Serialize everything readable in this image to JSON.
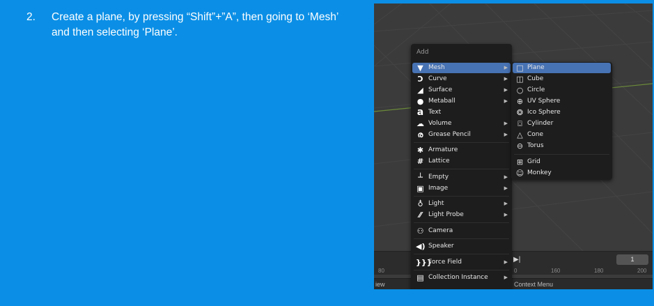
{
  "instruction": {
    "number": "2.",
    "text": "Create a plane, by pressing “Shift”+”A”, then going to ‘Mesh’ and then selecting ‘Plane’."
  },
  "add_menu": {
    "title": "Add",
    "items": [
      {
        "label": "Mesh",
        "icon": "mesh-icon",
        "submenu": true,
        "active": true
      },
      {
        "label": "Curve",
        "icon": "curve-icon",
        "submenu": true
      },
      {
        "label": "Surface",
        "icon": "surface-icon",
        "submenu": true
      },
      {
        "label": "Metaball",
        "icon": "metaball-icon",
        "submenu": true
      },
      {
        "label": "Text",
        "icon": "text-icon",
        "submenu": false
      },
      {
        "label": "Volume",
        "icon": "volume-icon",
        "submenu": true
      },
      {
        "label": "Grease Pencil",
        "icon": "grease-pencil-icon",
        "submenu": true
      },
      {
        "label": "Armature",
        "icon": "armature-icon",
        "submenu": false
      },
      {
        "label": "Lattice",
        "icon": "lattice-icon",
        "submenu": false
      },
      {
        "label": "Empty",
        "icon": "empty-icon",
        "submenu": true
      },
      {
        "label": "Image",
        "icon": "image-icon",
        "submenu": true
      },
      {
        "label": "Light",
        "icon": "light-icon",
        "submenu": true
      },
      {
        "label": "Light Probe",
        "icon": "light-probe-icon",
        "submenu": true
      },
      {
        "label": "Camera",
        "icon": "camera-icon",
        "submenu": false
      },
      {
        "label": "Speaker",
        "icon": "speaker-icon",
        "submenu": false
      },
      {
        "label": "Force Field",
        "icon": "force-field-icon",
        "submenu": true
      },
      {
        "label": "Collection Instance",
        "icon": "collection-icon",
        "submenu": true
      }
    ]
  },
  "mesh_submenu": {
    "items": [
      {
        "label": "Plane",
        "icon": "plane-icon",
        "active": true
      },
      {
        "label": "Cube",
        "icon": "cube-icon"
      },
      {
        "label": "Circle",
        "icon": "circle-icon"
      },
      {
        "label": "UV Sphere",
        "icon": "uv-sphere-icon"
      },
      {
        "label": "Ico Sphere",
        "icon": "ico-sphere-icon"
      },
      {
        "label": "Cylinder",
        "icon": "cylinder-icon"
      },
      {
        "label": "Cone",
        "icon": "cone-icon"
      },
      {
        "label": "Torus",
        "icon": "torus-icon"
      },
      {
        "label": "Grid",
        "icon": "grid-icon"
      },
      {
        "label": "Monkey",
        "icon": "monkey-icon"
      }
    ]
  },
  "timeline": {
    "current_frame": "1",
    "ruler": [
      "80",
      "0",
      "160",
      "180",
      "200"
    ]
  },
  "statusbar": {
    "left": "iew",
    "right": "Context Menu"
  },
  "colors": {
    "background": "#0b8fe6",
    "highlight": "#4772b3",
    "menu_bg": "#1d1d1d"
  }
}
